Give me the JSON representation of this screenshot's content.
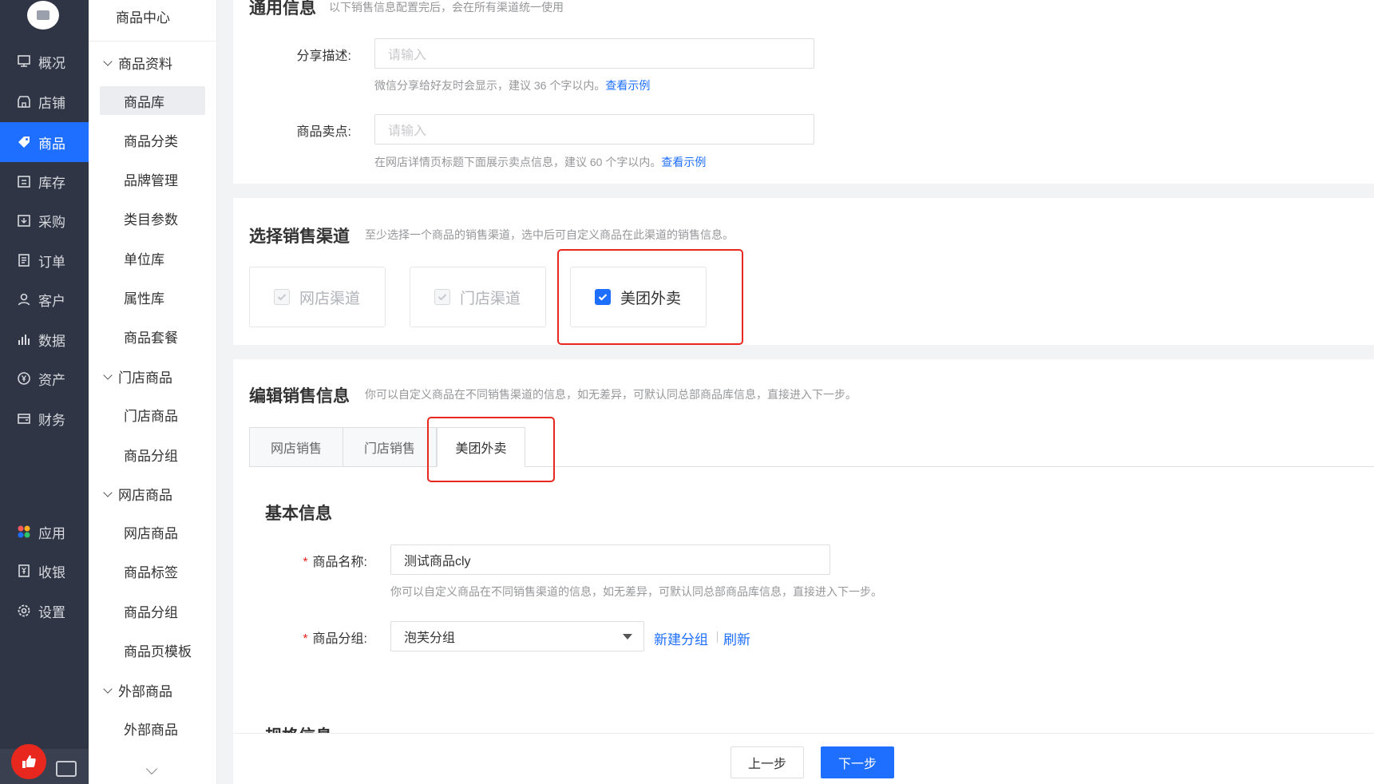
{
  "nav": {
    "items": [
      {
        "label": "概况",
        "icon": "dashboard-icon"
      },
      {
        "label": "店铺",
        "icon": "store-icon"
      },
      {
        "label": "商品",
        "icon": "tag-icon"
      },
      {
        "label": "库存",
        "icon": "warehouse-icon"
      },
      {
        "label": "采购",
        "icon": "purchase-icon"
      },
      {
        "label": "订单",
        "icon": "order-icon"
      },
      {
        "label": "客户",
        "icon": "user-icon"
      },
      {
        "label": "数据",
        "icon": "chart-icon"
      },
      {
        "label": "资产",
        "icon": "yen-circle-icon"
      },
      {
        "label": "财务",
        "icon": "wallet-icon"
      },
      {
        "label": "应用",
        "icon": "apps-icon"
      },
      {
        "label": "收银",
        "icon": "cashier-icon"
      },
      {
        "label": "设置",
        "icon": "gear-icon"
      }
    ],
    "active": "商品"
  },
  "subnav": {
    "title": "商品中心",
    "groups": [
      {
        "label": "商品资料",
        "items": [
          "商品库",
          "商品分类",
          "品牌管理",
          "类目参数",
          "单位库",
          "属性库",
          "商品套餐"
        ]
      },
      {
        "label": "门店商品",
        "items": [
          "门店商品",
          "商品分组"
        ]
      },
      {
        "label": "网店商品",
        "items": [
          "网店商品",
          "商品标签",
          "商品分组",
          "商品页模板"
        ]
      },
      {
        "label": "外部商品",
        "items": [
          "外部商品"
        ]
      }
    ],
    "selected": "商品库"
  },
  "general": {
    "title": "通用信息",
    "desc": "以下销售信息配置完后，会在所有渠道统一使用",
    "share_label": "分享描述:",
    "share_placeholder": "请输入",
    "share_hint": "微信分享给好友时会显示，建议 36 个字以内。",
    "selling_label": "商品卖点:",
    "selling_placeholder": "请输入",
    "selling_hint": "在网店详情页标题下面展示卖点信息，建议 60 个字以内。",
    "example_link": "查看示例"
  },
  "channels": {
    "title": "选择销售渠道",
    "desc": "至少选择一个商品的销售渠道，选中后可自定义商品在此渠道的销售信息。",
    "options": [
      {
        "label": "网店渠道",
        "checked": true,
        "disabled": true
      },
      {
        "label": "门店渠道",
        "checked": true,
        "disabled": true
      },
      {
        "label": "美团外卖",
        "checked": true,
        "disabled": false
      }
    ]
  },
  "edit": {
    "title": "编辑销售信息",
    "desc": "你可以自定义商品在不同销售渠道的信息，如无差异，可默认同总部商品库信息，直接进入下一步。",
    "tabs": [
      "网店销售",
      "门店销售",
      "美团外卖"
    ],
    "active_tab": "美团外卖",
    "basic_title": "基本信息",
    "name_label": "商品名称:",
    "name_value": "测试商品cly",
    "name_hint": "你可以自定义商品在不同销售渠道的信息，如无差异，可默认同总部商品库信息，直接进入下一步。",
    "group_label": "商品分组:",
    "group_value": "泡芙分组",
    "new_group": "新建分组",
    "refresh": "刷新",
    "spec_title": "规格信息"
  },
  "footer": {
    "prev": "上一步",
    "next": "下一步"
  },
  "colors": {
    "primary": "#1e6fff",
    "nav_bg": "#2f3544",
    "highlight": "#e8281e"
  }
}
